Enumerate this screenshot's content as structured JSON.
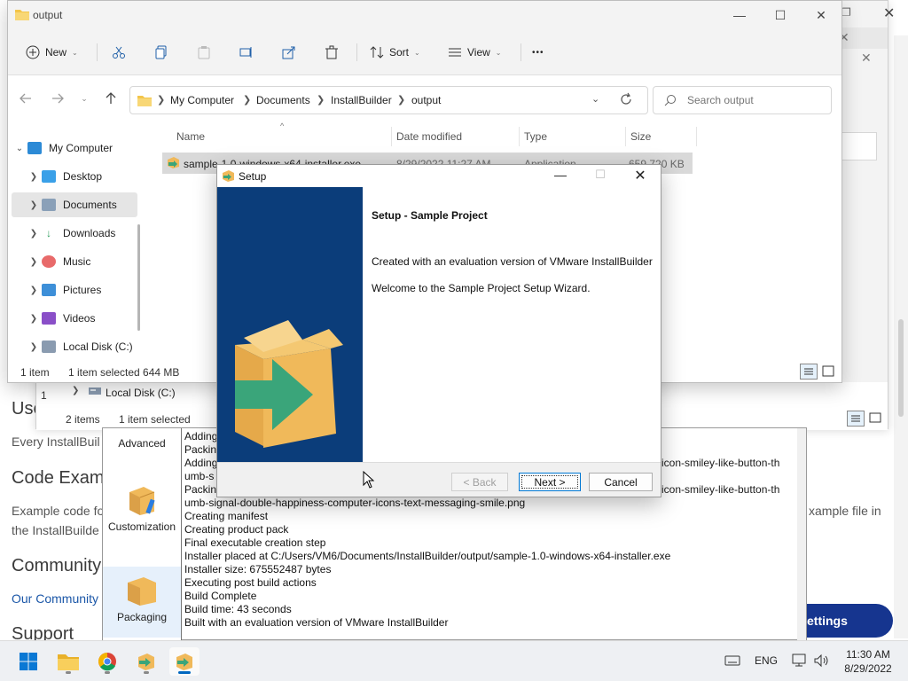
{
  "webpage": {
    "headings": [
      "User",
      "Code Exam",
      "Community",
      "Support"
    ],
    "texts": [
      "Every InstallBuil",
      "Example code fo",
      "the InstallBuilde",
      "Our Community"
    ],
    "right_fragment": "xample file in",
    "settings_label": "ettings"
  },
  "back_explorer": {
    "nav_item": "Local Disk (C:)",
    "status_count": "2 items",
    "status_selected": "1 item selected",
    "count_fragment": "1"
  },
  "installbuilder": {
    "categories": [
      {
        "label": "Advanced"
      },
      {
        "label": "Customization"
      },
      {
        "label": "Packaging"
      }
    ],
    "log": [
      "Adding",
      "Packin",
      "Adding",
      "umb-s",
      "Packin",
      "umb-signal-double-happiness-computer-icons-text-messaging-smile.png",
      "Creating manifest",
      "Creating product pack",
      "Final executable creation step",
      "Installer placed at C:/Users/VM6/Documents/InstallBuilder/output/sample-1.0-windows-x64-installer.exe",
      "Installer size: 675552487 bytes",
      "Executing post build actions",
      "Build Complete",
      "Build time: 43 seconds",
      "Built with an evaluation version of VMware InstallBuilder"
    ],
    "log_right_fragments": [
      "icon-smiley-like-button-th",
      "icon-smiley-like-button-th"
    ]
  },
  "explorer": {
    "title": "output",
    "toolbar": {
      "new": "New",
      "sort": "Sort",
      "view": "View",
      "more": "•••"
    },
    "breadcrumb": [
      "My Computer",
      "Documents",
      "InstallBuilder",
      "output"
    ],
    "search_placeholder": "Search output",
    "nav": [
      {
        "label": "My Computer"
      },
      {
        "label": "Desktop"
      },
      {
        "label": "Documents"
      },
      {
        "label": "Downloads"
      },
      {
        "label": "Music"
      },
      {
        "label": "Pictures"
      },
      {
        "label": "Videos"
      },
      {
        "label": "Local Disk (C:)"
      }
    ],
    "columns": {
      "name": "Name",
      "date": "Date modified",
      "type": "Type",
      "size": "Size"
    },
    "file": {
      "name": "sample-1.0-windows-x64-installer.exe",
      "date": "8/29/2022 11:27 AM",
      "type": "Application",
      "size": "659,720 KB"
    },
    "status": {
      "count": "1 item",
      "selected": "1 item selected  644 MB"
    }
  },
  "setup": {
    "title": "Setup",
    "heading": "Setup - Sample Project",
    "line1": "Created with an evaluation version of VMware InstallBuilder",
    "line2": "Welcome to the Sample Project Setup Wizard.",
    "back": "< Back",
    "next": "Next >",
    "cancel": "Cancel"
  },
  "taskbar": {
    "lang": "ENG",
    "time": "11:30 AM",
    "date": "8/29/2022"
  },
  "colors": {
    "setup_side": "#0b3d7a",
    "accent": "#0067c0",
    "settings_button": "#16358f",
    "box": "#f0b95a",
    "arrow": "#3aa57a"
  }
}
